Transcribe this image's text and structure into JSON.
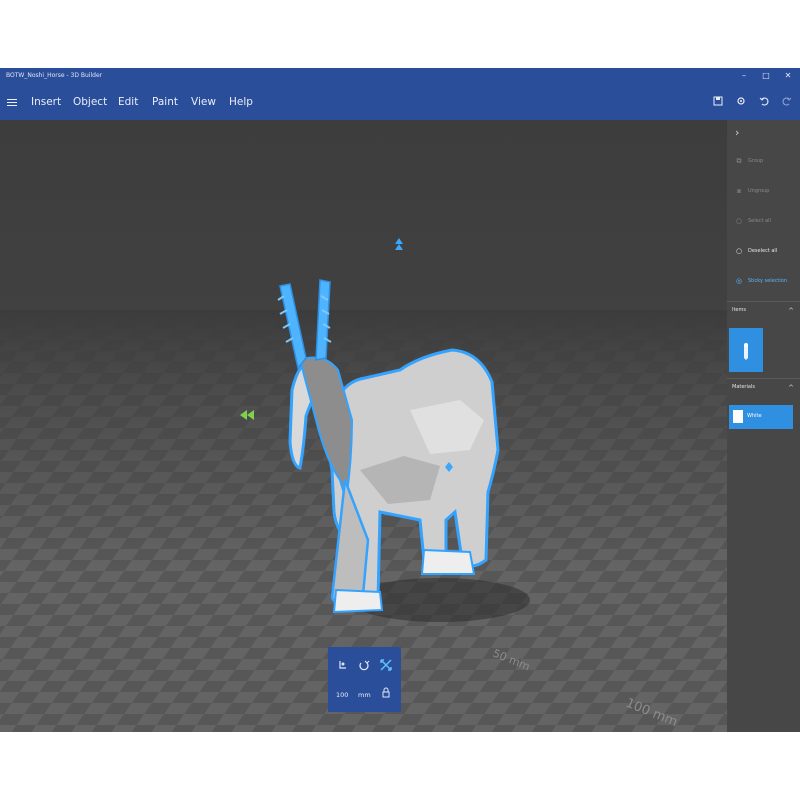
{
  "window": {
    "title": "BOTW_Noshi_Horse - 3D Builder",
    "minimize_glyph": "–",
    "maximize_glyph": "□",
    "close_glyph": "✕"
  },
  "menu": {
    "items": [
      "Insert",
      "Object",
      "Edit",
      "Paint",
      "View",
      "Help"
    ],
    "toolbar_icons": [
      "save-icon",
      "settings-icon",
      "undo-icon",
      "redo-icon"
    ]
  },
  "panel": {
    "collapse_glyph": "›",
    "actions": [
      {
        "icon": "group-icon",
        "label": "Group",
        "enabled": false
      },
      {
        "icon": "ungroup-icon",
        "label": "Ungroup",
        "enabled": false
      },
      {
        "icon": "select-all-icon",
        "label": "Select all",
        "enabled": false
      },
      {
        "icon": "deselect-all-icon",
        "label": "Deselect all",
        "enabled": true
      },
      {
        "icon": "sticky-selection-icon",
        "label": "Sticky selection",
        "enabled": true
      }
    ],
    "items_section": {
      "label": "Items",
      "chevron": "^"
    },
    "materials_section": {
      "label": "Materials",
      "chevron": "^"
    },
    "material": {
      "label": "White",
      "swatch": "#ffffff"
    }
  },
  "viewport": {
    "ruler_labels": [
      "50 mm",
      "100 mm"
    ]
  },
  "size_toolbar": {
    "value": "100",
    "unit": "mm"
  },
  "colors": {
    "accent": "#2b4e9a",
    "selection": "#2fa0ff",
    "gizmo_up": "#3aa8ff",
    "gizmo_left": "#7fd14b"
  }
}
